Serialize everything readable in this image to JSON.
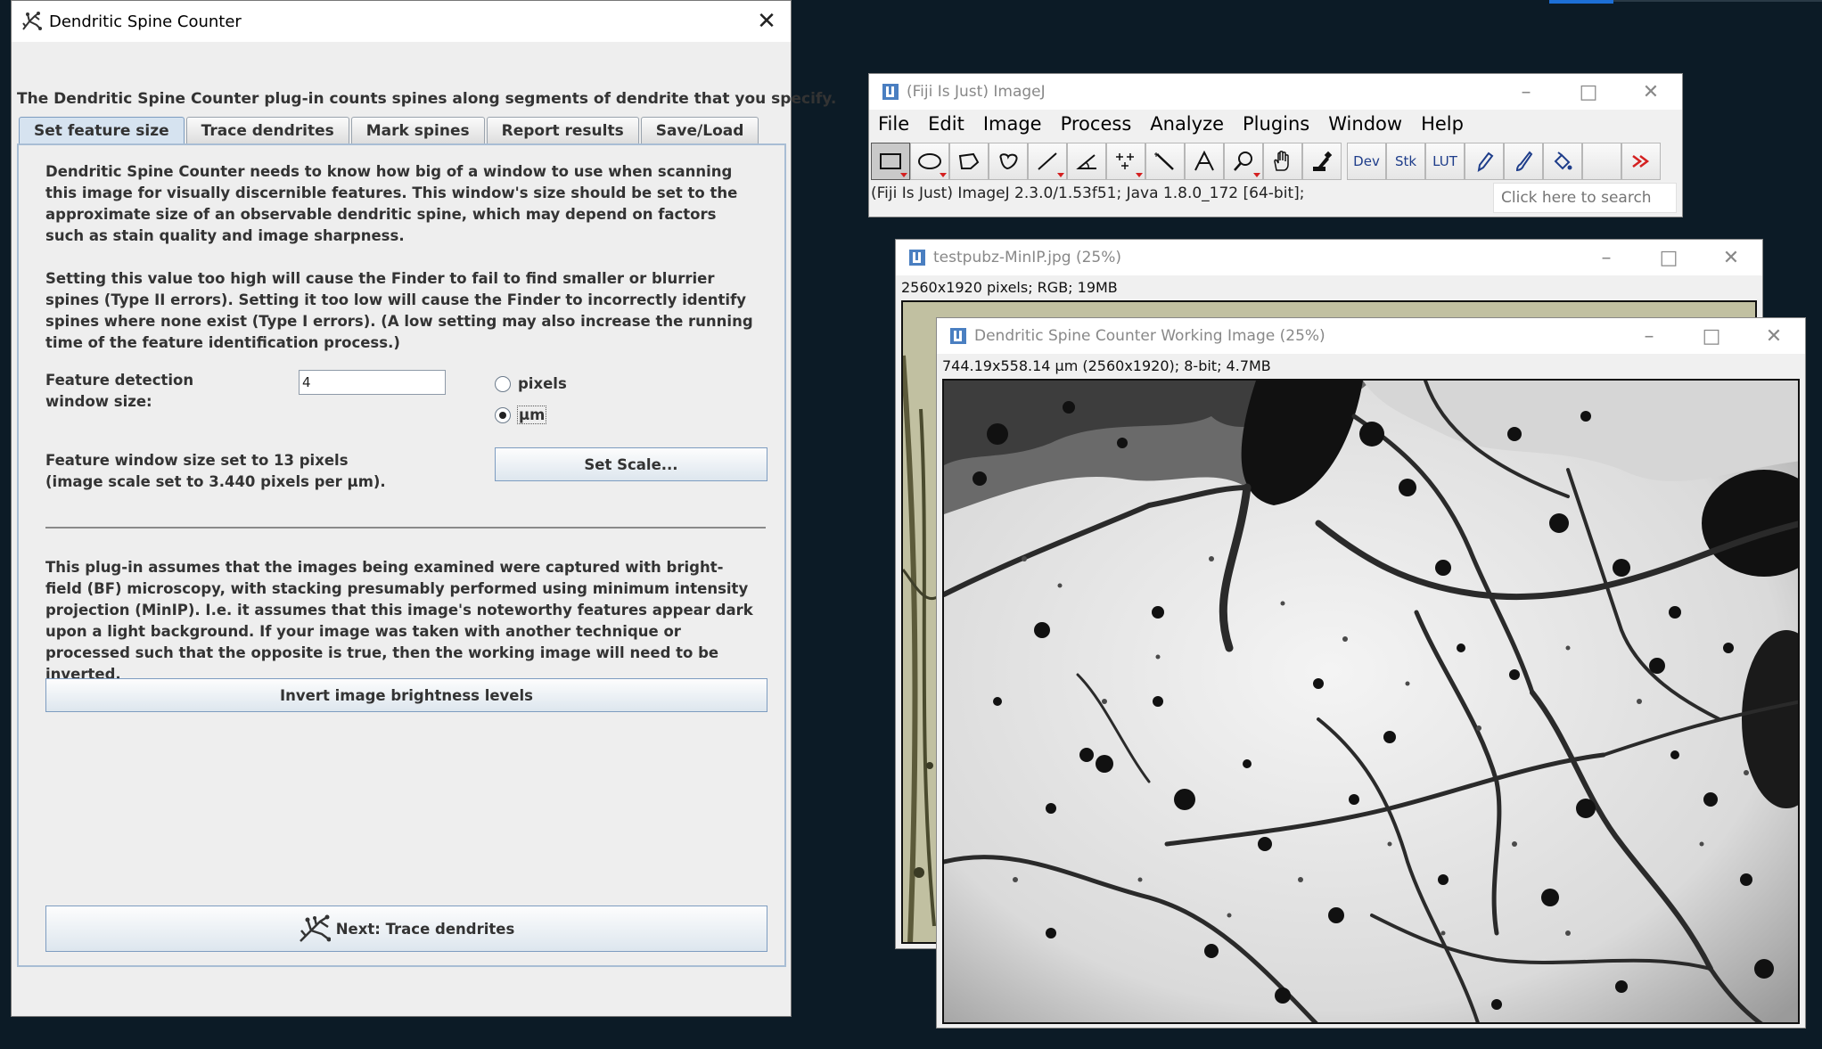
{
  "dialog": {
    "title": "Dendritic Spine Counter",
    "intro": "The Dendritic Spine Counter plug-in counts spines along segments of dendrite that you specify.",
    "tabs": [
      "Set feature size",
      "Trace dendrites",
      "Mark spines",
      "Report results",
      "Save/Load"
    ],
    "paragraph1": "Dendritic Spine Counter needs to know how big of a window to use when scanning this image for visually discernible features. This window's size should be set to the approximate size of an observable dendritic spine, which may depend on factors such as stain quality and image sharpness.",
    "paragraph2": "Setting this value too high will cause the Finder to fail to find smaller or blurrier spines (Type II errors). Setting it too low will cause the Finder to incorrectly identify spines where none exist (Type I errors). (A low setting may also increase the running time of the feature identification process.)",
    "field_label": "Feature detection window size:",
    "field_value": "4",
    "unit_options": [
      "pixels",
      "µm"
    ],
    "unit_selected": "µm",
    "status_line1": "Feature window size set to 13 pixels",
    "status_line2": "(image scale set to 3.440 pixels per µm).",
    "set_scale_label": "Set Scale...",
    "paragraph3": "This plug-in assumes that the images being examined were captured with bright-field (BF) microscopy, with stacking presumably performed using minimum intensity projection (MinIP). I.e. it assumes that this image's noteworthy features appear dark upon a light background. If your image was taken with another technique or processed such that the opposite is true, then the working image will need to be inverted.",
    "invert_label": "Invert image brightness levels",
    "next_label": "Next: Trace dendrites"
  },
  "imagej": {
    "title": "(Fiji Is Just) ImageJ",
    "menus": [
      "File",
      "Edit",
      "Image",
      "Process",
      "Analyze",
      "Plugins",
      "Window",
      "Help"
    ],
    "tools": [
      "rectangle",
      "oval",
      "polygon",
      "freehand",
      "line",
      "angle",
      "multipoint",
      "wand",
      "text",
      "magnifier",
      "hand",
      "dropper",
      "Dev",
      "Stk",
      "LUT",
      "pencil",
      "brush",
      "flood-fill",
      "blank",
      "more-tools"
    ],
    "status": "(Fiji Is Just) ImageJ 2.3.0/1.53f51; Java 1.8.0_172 [64-bit];",
    "search_placeholder": "Click here to search"
  },
  "image1": {
    "title": "testpubz-MinIP.jpg (25%)",
    "info": "2560x1920 pixels; RGB; 19MB"
  },
  "image2": {
    "title": "Dendritic Spine Counter Working Image (25%)",
    "info": "744.19x558.14 µm (2560x1920); 8-bit; 4.7MB"
  },
  "window_controls": {
    "minimize": "–",
    "maximize": "□",
    "close": "✕"
  },
  "colors": {
    "desktop": "#0c1b26",
    "tab_active": "#d6e3f0",
    "button_border": "#7d9cc0",
    "accent": "#1d6fd6"
  }
}
